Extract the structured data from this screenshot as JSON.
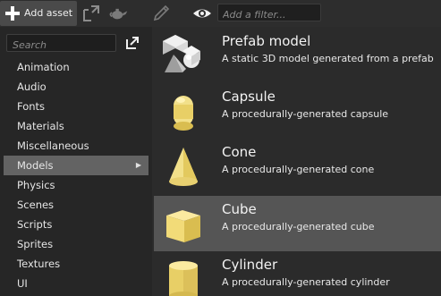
{
  "toolbar": {
    "add_asset_label": "Add asset",
    "filter_placeholder": "Add a filter..."
  },
  "sidebar": {
    "search_placeholder": "Search",
    "categories": [
      {
        "label": "Animation"
      },
      {
        "label": "Audio"
      },
      {
        "label": "Fonts"
      },
      {
        "label": "Materials"
      },
      {
        "label": "Miscellaneous"
      },
      {
        "label": "Models",
        "selected": true
      },
      {
        "label": "Physics"
      },
      {
        "label": "Scenes"
      },
      {
        "label": "Scripts"
      },
      {
        "label": "Sprites"
      },
      {
        "label": "Textures"
      },
      {
        "label": "UI"
      }
    ]
  },
  "assets": [
    {
      "title": "Prefab model",
      "description": "A static 3D model generated from a prefab",
      "icon": "prefab-model-icon"
    },
    {
      "title": "Capsule",
      "description": "A procedurally-generated capsule",
      "icon": "capsule-icon"
    },
    {
      "title": "Cone",
      "description": "A procedurally-generated cone",
      "icon": "cone-icon"
    },
    {
      "title": "Cube",
      "description": "A procedurally-generated cube",
      "icon": "cube-icon",
      "selected": true
    },
    {
      "title": "Cylinder",
      "description": "A procedurally-generated cylinder",
      "icon": "cylinder-icon"
    }
  ],
  "colors": {
    "accent_yellow": "#f2e08a",
    "selection": "#555555",
    "sidebar_selection": "#636363"
  }
}
